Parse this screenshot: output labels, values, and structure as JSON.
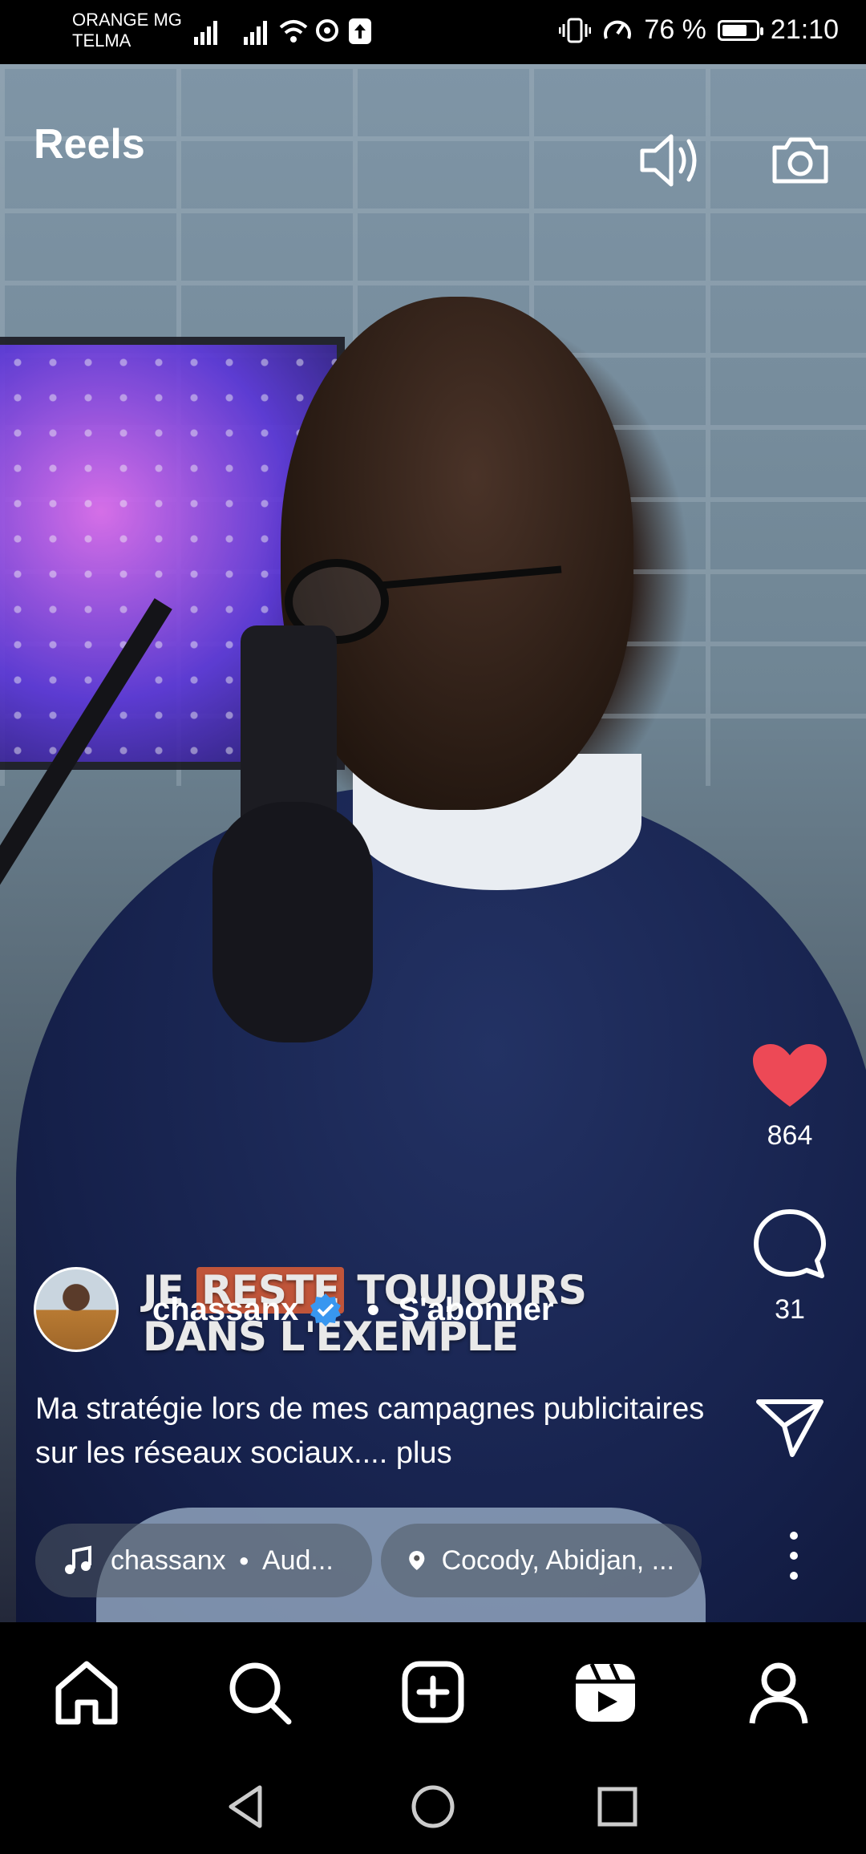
{
  "status_bar": {
    "carrier_line1": "ORANGE MG",
    "carrier_line2": "TELMA",
    "battery_text": "76 %",
    "battery_level": 0.76,
    "time": "21:10"
  },
  "header": {
    "title": "Reels",
    "icons": [
      "speaker-icon",
      "camera-icon"
    ]
  },
  "video": {
    "caption_line1_before": "JE ",
    "caption_highlight": "RESTE",
    "caption_line1_after": " TOUJOURS",
    "caption_line2": "DANS L'EXEMPLE"
  },
  "actions": {
    "likes": "864",
    "comments": "31",
    "like_color": "#ed4956"
  },
  "post": {
    "username": "chassanx",
    "subscribe_label": "S'abonner",
    "description": "Ma stratégie lors de mes campagnes publicitaires sur les réseaux sociaux.... plus",
    "audio_label": "chassanx",
    "audio_suffix": "Aud...",
    "location": "Cocody, Abidjan, ..."
  },
  "nav": {
    "items": [
      "home-icon",
      "search-icon",
      "create-icon",
      "reels-icon",
      "profile-icon"
    ]
  },
  "system_nav": [
    "back-icon",
    "home-circle-icon",
    "recents-icon"
  ]
}
